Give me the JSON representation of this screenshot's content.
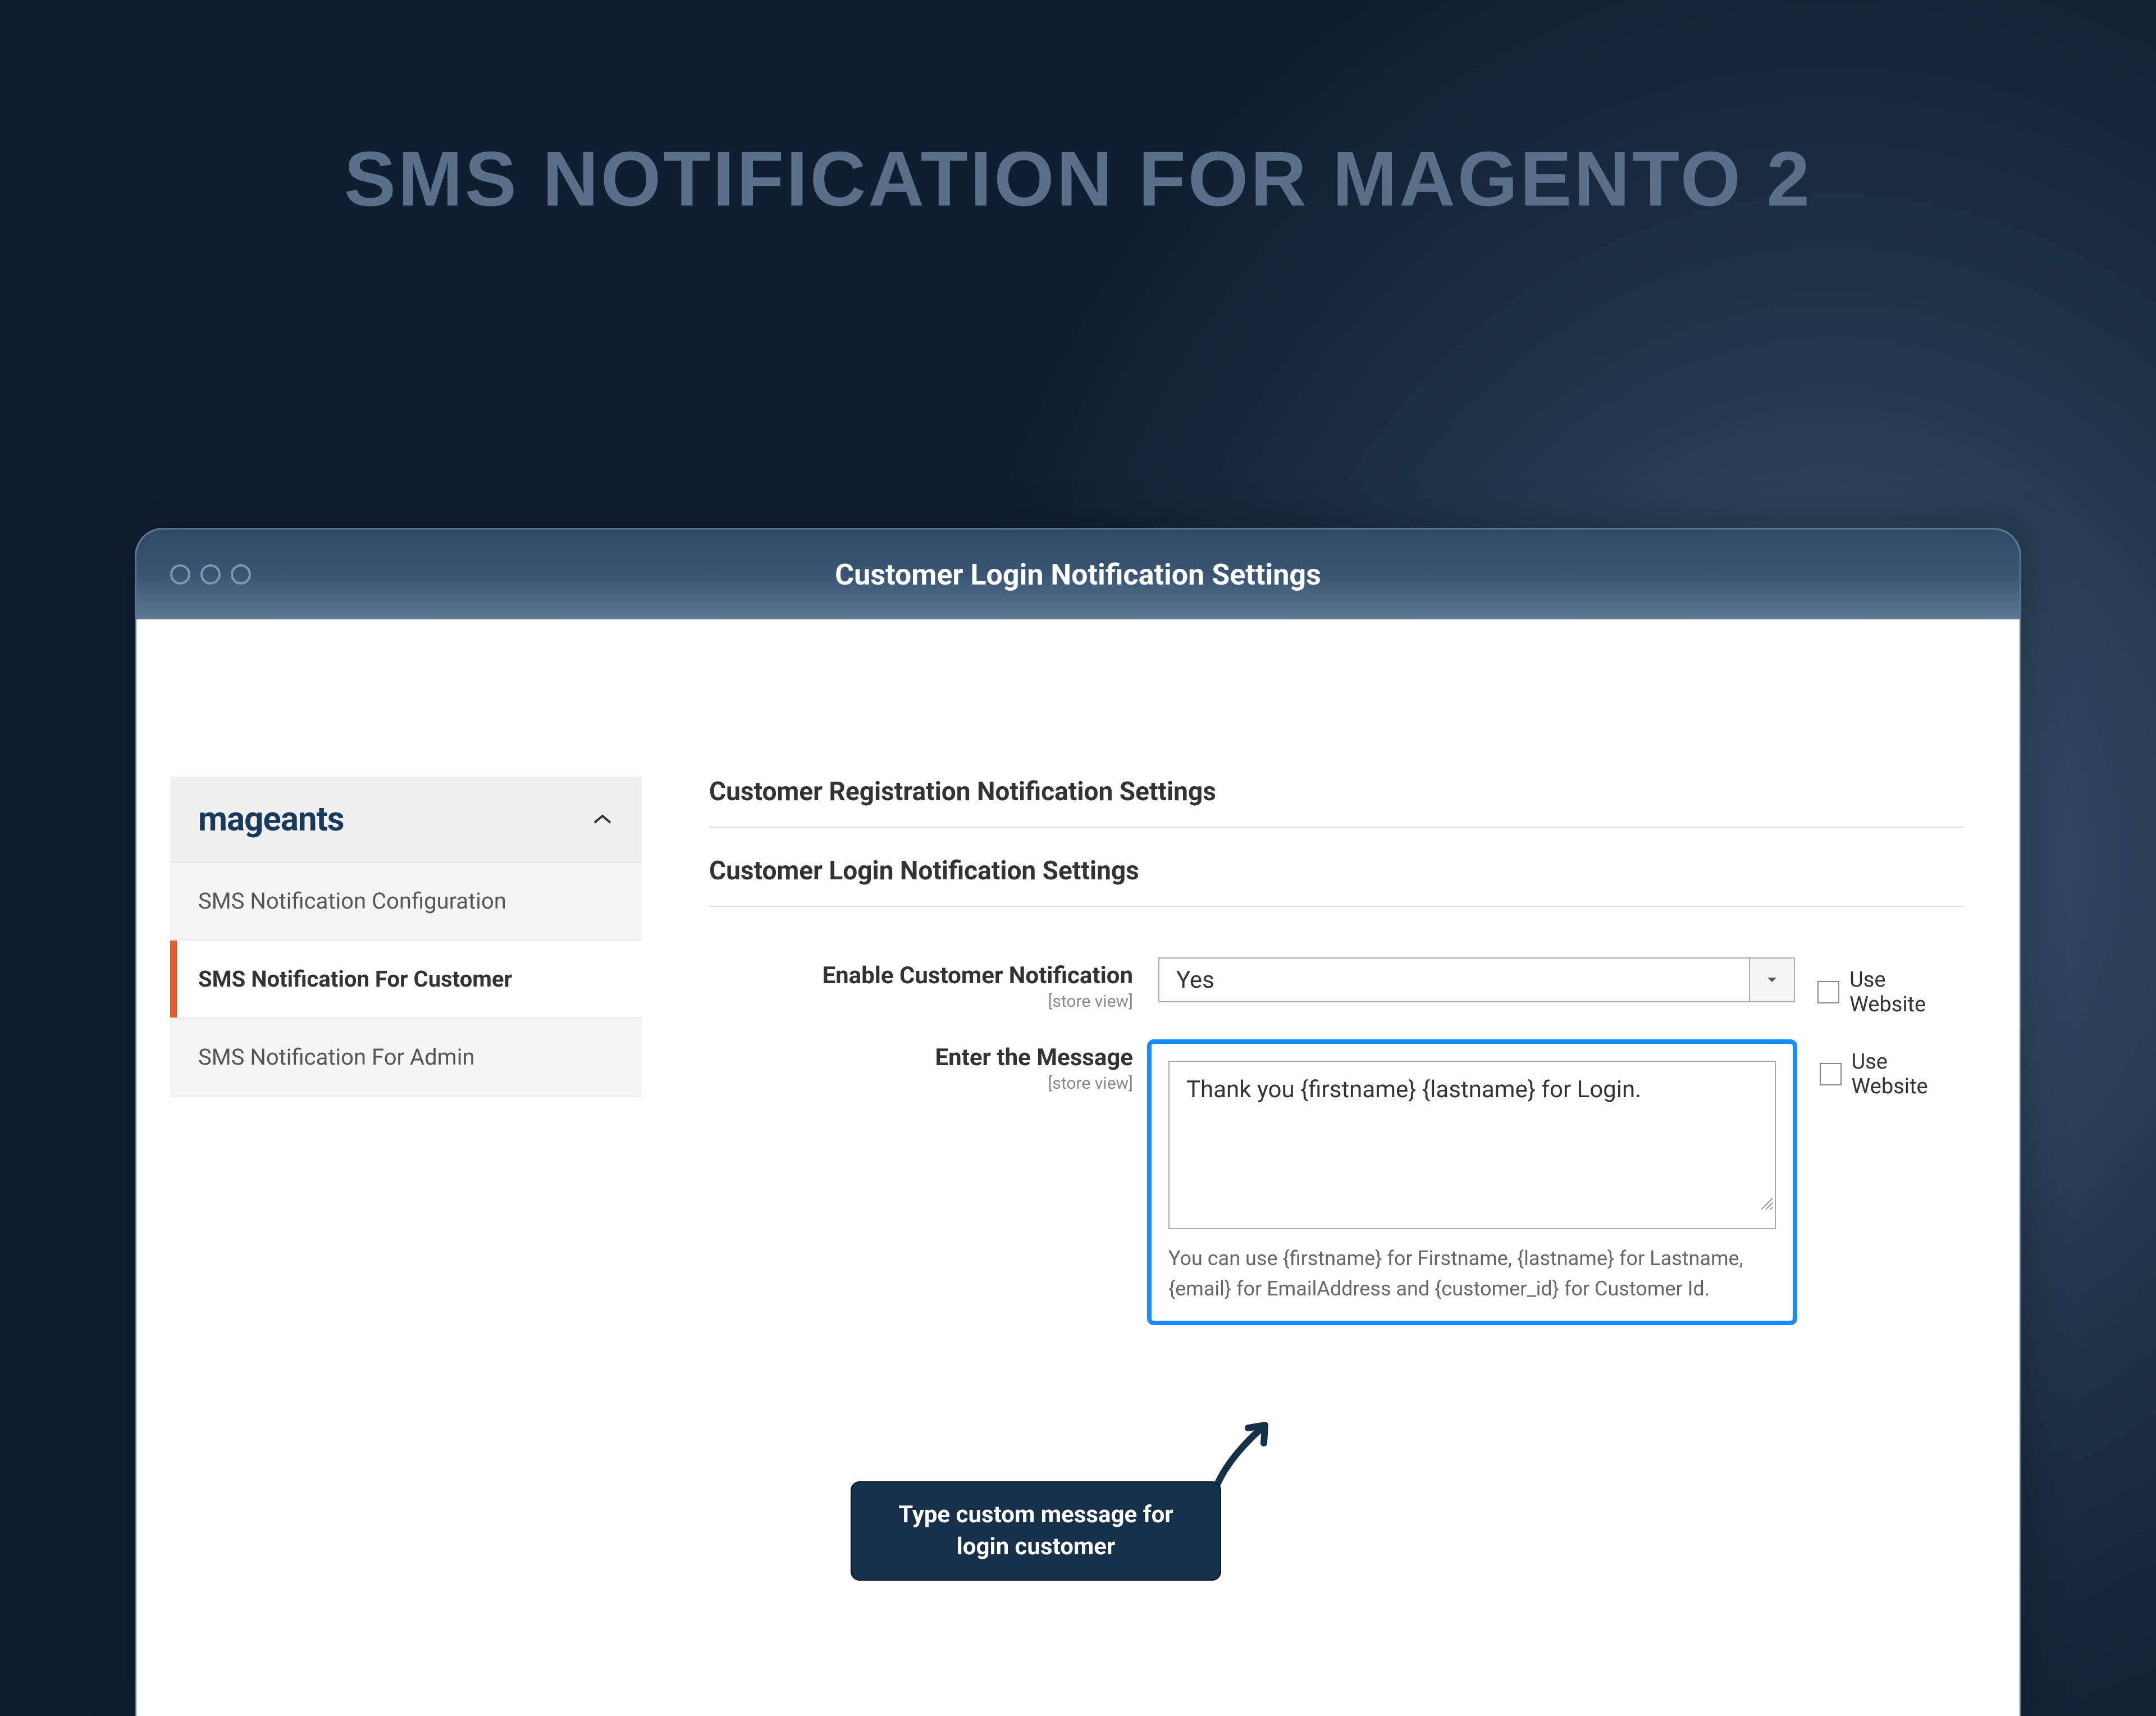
{
  "hero": {
    "title": "SMS NOTIFICATION FOR MAGENTO 2"
  },
  "window": {
    "title": "Customer Login Notification Settings"
  },
  "sidebar": {
    "logo": "mageants",
    "items": [
      {
        "label": "SMS Notification Configuration"
      },
      {
        "label": "SMS Notification For Customer"
      },
      {
        "label": "SMS Notification For Admin"
      }
    ]
  },
  "sections": {
    "registration": {
      "heading": "Customer Registration Notification Settings"
    },
    "login": {
      "heading": "Customer Login Notification Settings"
    }
  },
  "form": {
    "enable": {
      "label": "Enable Customer Notification",
      "scope": "[store view]",
      "value": "Yes",
      "checkbox": "Use Website"
    },
    "message": {
      "label": "Enter the Message",
      "scope": "[store view]",
      "value": "Thank you {firstname} {lastname} for Login.",
      "help": "You can use {firstname} for Firstname, {lastname} for Lastname, {email} for EmailAddress and {customer_id} for Customer Id.",
      "checkbox": "Use Website"
    }
  },
  "callout": {
    "text": "Type custom message for login customer"
  }
}
